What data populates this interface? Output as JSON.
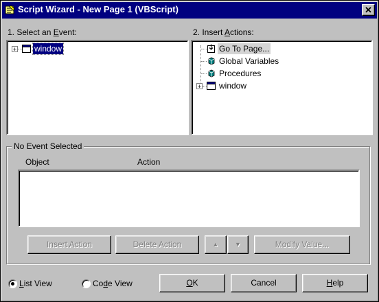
{
  "window": {
    "title": "Script Wizard - New Page 1 (VBScript)",
    "close_glyph": "✕"
  },
  "event_panel": {
    "label_prefix": "1. Select an ",
    "label_accel": "E",
    "label_suffix": "vent:",
    "tree": [
      {
        "label": "window",
        "selected": true,
        "icon": "window-icon"
      }
    ]
  },
  "actions_panel": {
    "label_prefix": "2. Insert ",
    "label_accel": "A",
    "label_suffix": "ctions:",
    "tree": [
      {
        "label": "Go To Page...",
        "icon": "goto-page-icon",
        "highlighted": true
      },
      {
        "label": "Global Variables",
        "icon": "cube-icon"
      },
      {
        "label": "Procedures",
        "icon": "cube-icon"
      },
      {
        "label": "window",
        "icon": "window-icon",
        "expandable": true
      }
    ]
  },
  "event_group": {
    "title": "No Event Selected",
    "columns": {
      "object": "Object",
      "action": "Action"
    },
    "buttons": {
      "insert_action": "Insert Action",
      "delete_action": "Delete Action",
      "move_up": "▲",
      "move_down": "▼",
      "modify_value": "Modify Value..."
    }
  },
  "view_options": {
    "list_view_accel": "L",
    "list_view_rest": "ist View",
    "code_view_prefix": "Co",
    "code_view_accel": "d",
    "code_view_rest": "e View",
    "selected": "list"
  },
  "dialog_buttons": {
    "ok_accel": "O",
    "ok_rest": "K",
    "cancel": "Cancel",
    "help_accel": "H",
    "help_rest": "elp"
  },
  "colors": {
    "titlebar": "#000080",
    "face": "#c0c0c0",
    "selection": "#000080"
  }
}
